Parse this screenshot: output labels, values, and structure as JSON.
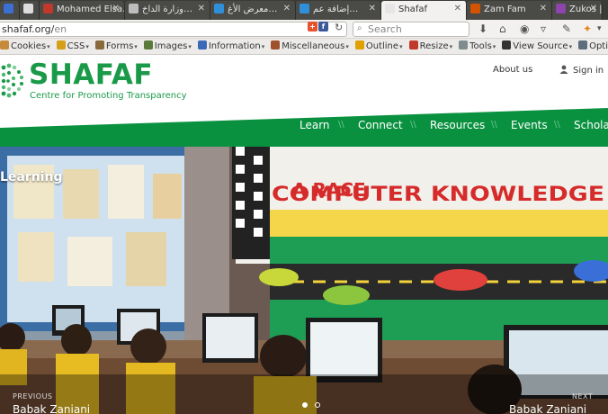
{
  "tabs": [
    {
      "label": "",
      "favicon_color": "#3b6fd1",
      "active": false
    },
    {
      "label": "",
      "favicon_color": "#dddddd",
      "active": false
    },
    {
      "label": "Mohamed Elsa…",
      "favicon_color": "#c0392b",
      "active": false
    },
    {
      "label": "وزارة الداخ…",
      "favicon_color": "#bdbdbd",
      "active": false
    },
    {
      "label": "معرض الأغ…",
      "favicon_color": "#2f8fd8",
      "active": false
    },
    {
      "label": "إضافة عم…",
      "favicon_color": "#2f8fd8",
      "active": false
    },
    {
      "label": "Shafaf",
      "favicon_color": "#e6e6e6",
      "active": true
    },
    {
      "label": "Zam Fam",
      "favicon_color": "#d35400",
      "active": false
    },
    {
      "label": "Zukos | Zu…",
      "favicon_color": "#8e44ad",
      "active": false
    }
  ],
  "address": {
    "url_main": "shafaf.org/",
    "url_path": "en",
    "search_placeholder": "Search"
  },
  "devtoolbar": [
    "Cookies",
    "CSS",
    "Forms",
    "Images",
    "Information",
    "Miscellaneous",
    "Outline",
    "Resize",
    "Tools",
    "View Source",
    "Options"
  ],
  "site": {
    "logo": "SHAFAF",
    "tagline": "Centre for Promoting Transparency",
    "about": "About us",
    "signin": "Sign in",
    "brand_color": "#0a9140"
  },
  "mainnav": [
    "Learn",
    "Connect",
    "Resources",
    "Events",
    "Scholar"
  ],
  "nav_separator": "\\\\",
  "hero": {
    "title": "Learning",
    "prev_label": "PREVIOUS",
    "prev_name": "Babak Zaniani",
    "next_label": "NEXT",
    "next_name": "Babak Zaniani",
    "banner_text_1": "A RACE",
    "banner_text_2": "COMPUTER KNOWLEDGE",
    "slide_count": 2,
    "active_slide": 1
  }
}
